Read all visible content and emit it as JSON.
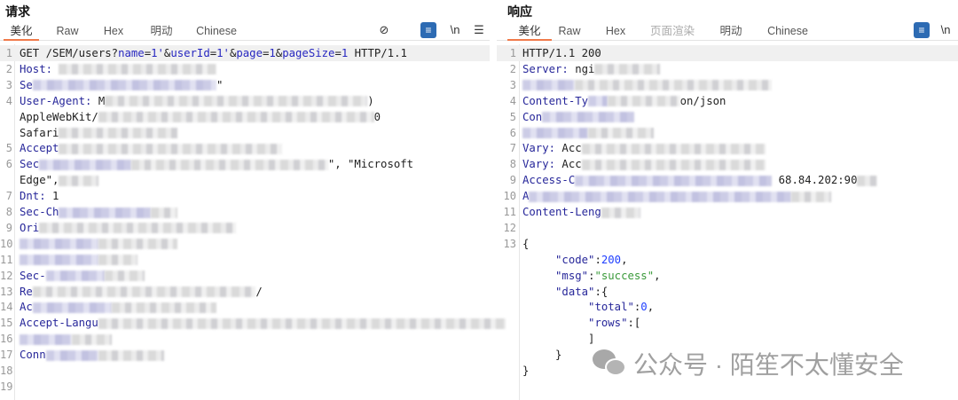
{
  "request": {
    "title": "请求",
    "tabs": [
      "美化",
      "Raw",
      "Hex",
      "明动",
      "Chinese"
    ],
    "tools": {
      "hide": "⊘",
      "wrap": "≡",
      "newline": "\\n",
      "menu": "☰"
    },
    "lines": [
      {
        "num": "1",
        "seg": [
          {
            "c": "t",
            "t": "GET /SEM/users?"
          },
          {
            "c": "p",
            "t": "name"
          },
          {
            "c": "t",
            "t": "="
          },
          {
            "c": "v",
            "t": "1'"
          },
          {
            "c": "t",
            "t": "&"
          },
          {
            "c": "p",
            "t": "userId"
          },
          {
            "c": "t",
            "t": "="
          },
          {
            "c": "v",
            "t": "1'"
          },
          {
            "c": "t",
            "t": "&"
          },
          {
            "c": "p",
            "t": "page"
          },
          {
            "c": "t",
            "t": "="
          },
          {
            "c": "v",
            "t": "1"
          },
          {
            "c": "t",
            "t": "&"
          },
          {
            "c": "p",
            "t": "pageSize"
          },
          {
            "c": "t",
            "t": "="
          },
          {
            "c": "v",
            "t": "1"
          },
          {
            "c": "t",
            "t": " HTTP/1.1"
          }
        ]
      },
      {
        "num": "2",
        "seg": [
          {
            "c": "k",
            "t": "Host: "
          },
          {
            "r": 24
          }
        ]
      },
      {
        "num": "3",
        "seg": [
          {
            "c": "k",
            "t": "Se"
          },
          {
            "r": 28,
            "b": 1
          },
          {
            "c": "t",
            "t": "\""
          }
        ]
      },
      {
        "num": "4",
        "seg": [
          {
            "c": "k",
            "t": "User-Agent: "
          },
          {
            "c": "t",
            "t": "M"
          },
          {
            "r": 40
          },
          {
            "c": "t",
            "t": ")"
          }
        ]
      },
      {
        "num": "",
        "seg": [
          {
            "c": "t",
            "t": "AppleWebKit/"
          },
          {
            "r": 42
          },
          {
            "c": "t",
            "t": "0"
          }
        ]
      },
      {
        "num": "",
        "seg": [
          {
            "c": "t",
            "t": "Safari"
          },
          {
            "r": 18
          }
        ]
      },
      {
        "num": "5",
        "seg": [
          {
            "c": "k",
            "t": "Accept"
          },
          {
            "r": 34
          }
        ]
      },
      {
        "num": "6",
        "seg": [
          {
            "c": "k",
            "t": "Sec"
          },
          {
            "r": 14,
            "b": 1
          },
          {
            "r": 30
          },
          {
            "c": "t",
            "t": "\", \"Microsoft"
          }
        ]
      },
      {
        "num": "",
        "seg": [
          {
            "c": "t",
            "t": "Edge\","
          },
          {
            "r": 6
          }
        ]
      },
      {
        "num": "7",
        "seg": [
          {
            "c": "k",
            "t": "Dnt: "
          },
          {
            "c": "t",
            "t": "1"
          }
        ]
      },
      {
        "num": "8",
        "seg": [
          {
            "c": "k",
            "t": "Sec-Ch"
          },
          {
            "r": 14,
            "b": 1
          },
          {
            "r": 4
          }
        ]
      },
      {
        "num": "9",
        "seg": [
          {
            "c": "k",
            "t": "Ori"
          },
          {
            "r": 30
          }
        ]
      },
      {
        "num": "10",
        "seg": [
          {
            "r": 12,
            "b": 1
          },
          {
            "r": 12
          }
        ]
      },
      {
        "num": "11",
        "seg": [
          {
            "r": 12,
            "b": 1
          },
          {
            "r": 6
          }
        ]
      },
      {
        "num": "12",
        "seg": [
          {
            "c": "k",
            "t": "Sec-"
          },
          {
            "r": 9,
            "b": 1
          },
          {
            "r": 6
          }
        ]
      },
      {
        "num": "13",
        "seg": [
          {
            "c": "k",
            "t": "Re"
          },
          {
            "r": 34
          },
          {
            "c": "t",
            "t": "/"
          }
        ]
      },
      {
        "num": "14",
        "seg": [
          {
            "c": "k",
            "t": "Ac"
          },
          {
            "r": 12,
            "b": 1
          },
          {
            "r": 16
          }
        ]
      },
      {
        "num": "15",
        "seg": [
          {
            "c": "k",
            "t": "Accept-Langu"
          },
          {
            "r": 62
          }
        ]
      },
      {
        "num": "16",
        "seg": [
          {
            "r": 8,
            "b": 1
          },
          {
            "r": 6
          }
        ]
      },
      {
        "num": "17",
        "seg": [
          {
            "c": "k",
            "t": "Conn"
          },
          {
            "r": 8,
            "b": 1
          },
          {
            "r": 10
          }
        ]
      },
      {
        "num": "18",
        "seg": []
      },
      {
        "num": "19",
        "seg": []
      }
    ]
  },
  "response": {
    "title": "响应",
    "tabs": [
      "美化",
      "Raw",
      "Hex",
      "页面渲染",
      "明动",
      "Chinese"
    ],
    "tools": {
      "wrap": "≡",
      "newline": "\\n"
    },
    "lines": [
      {
        "num": "1",
        "seg": [
          {
            "c": "t",
            "t": "HTTP/1.1 200"
          }
        ]
      },
      {
        "num": "2",
        "seg": [
          {
            "c": "k",
            "t": "Server: "
          },
          {
            "c": "t",
            "t": "ngi"
          },
          {
            "r": 10
          }
        ]
      },
      {
        "num": "3",
        "seg": [
          {
            "r": 8,
            "b": 1
          },
          {
            "r": 30
          }
        ]
      },
      {
        "num": "4",
        "seg": [
          {
            "c": "k",
            "t": "Content-Ty"
          },
          {
            "r": 3,
            "b": 1
          },
          {
            "r": 11
          },
          {
            "c": "t",
            "t": "on/json"
          }
        ]
      },
      {
        "num": "5",
        "seg": [
          {
            "c": "k",
            "t": "Con"
          },
          {
            "r": 14,
            "b": 1
          }
        ]
      },
      {
        "num": "6",
        "seg": [
          {
            "r": 10,
            "b": 1
          },
          {
            "r": 10
          }
        ]
      },
      {
        "num": "7",
        "seg": [
          {
            "c": "k",
            "t": "Vary: "
          },
          {
            "c": "t",
            "t": "Acc"
          },
          {
            "r": 28
          }
        ]
      },
      {
        "num": "8",
        "seg": [
          {
            "c": "k",
            "t": "Vary: "
          },
          {
            "c": "t",
            "t": "Acc"
          },
          {
            "r": 28
          }
        ]
      },
      {
        "num": "9",
        "seg": [
          {
            "c": "k",
            "t": "Access-C"
          },
          {
            "r": 30,
            "b": 1
          },
          {
            "c": "t",
            "t": " 68.84.202:90"
          },
          {
            "r": 3
          }
        ]
      },
      {
        "num": "10",
        "seg": [
          {
            "c": "k",
            "t": "A"
          },
          {
            "r": 40,
            "b": 1
          },
          {
            "r": 6
          }
        ]
      },
      {
        "num": "11",
        "seg": [
          {
            "c": "k",
            "t": "Content-Leng"
          },
          {
            "r": 6
          }
        ]
      },
      {
        "num": "12",
        "seg": []
      },
      {
        "num": "13",
        "seg": [
          {
            "c": "t",
            "t": "{"
          }
        ]
      },
      {
        "num": "",
        "seg": [
          {
            "c": "t",
            "t": "     "
          },
          {
            "c": "k",
            "t": "\"code\""
          },
          {
            "c": "t",
            "t": ":"
          },
          {
            "c": "n",
            "t": "200"
          },
          {
            "c": "t",
            "t": ","
          }
        ]
      },
      {
        "num": "",
        "seg": [
          {
            "c": "t",
            "t": "     "
          },
          {
            "c": "k",
            "t": "\"msg\""
          },
          {
            "c": "t",
            "t": ":"
          },
          {
            "c": "s",
            "t": "\"success\""
          },
          {
            "c": "t",
            "t": ","
          }
        ]
      },
      {
        "num": "",
        "seg": [
          {
            "c": "t",
            "t": "     "
          },
          {
            "c": "k",
            "t": "\"data\""
          },
          {
            "c": "t",
            "t": ":{"
          }
        ]
      },
      {
        "num": "",
        "seg": [
          {
            "c": "t",
            "t": "          "
          },
          {
            "c": "k",
            "t": "\"total\""
          },
          {
            "c": "t",
            "t": ":"
          },
          {
            "c": "n",
            "t": "0"
          },
          {
            "c": "t",
            "t": ","
          }
        ]
      },
      {
        "num": "",
        "seg": [
          {
            "c": "t",
            "t": "          "
          },
          {
            "c": "k",
            "t": "\"rows\""
          },
          {
            "c": "t",
            "t": ":["
          }
        ]
      },
      {
        "num": "",
        "seg": [
          {
            "c": "t",
            "t": "          ]"
          }
        ]
      },
      {
        "num": "",
        "seg": [
          {
            "c": "t",
            "t": "     }"
          }
        ]
      },
      {
        "num": "",
        "seg": [
          {
            "c": "t",
            "t": "}"
          }
        ]
      }
    ]
  },
  "watermark": "公众号 · 陌笙不太懂安全"
}
